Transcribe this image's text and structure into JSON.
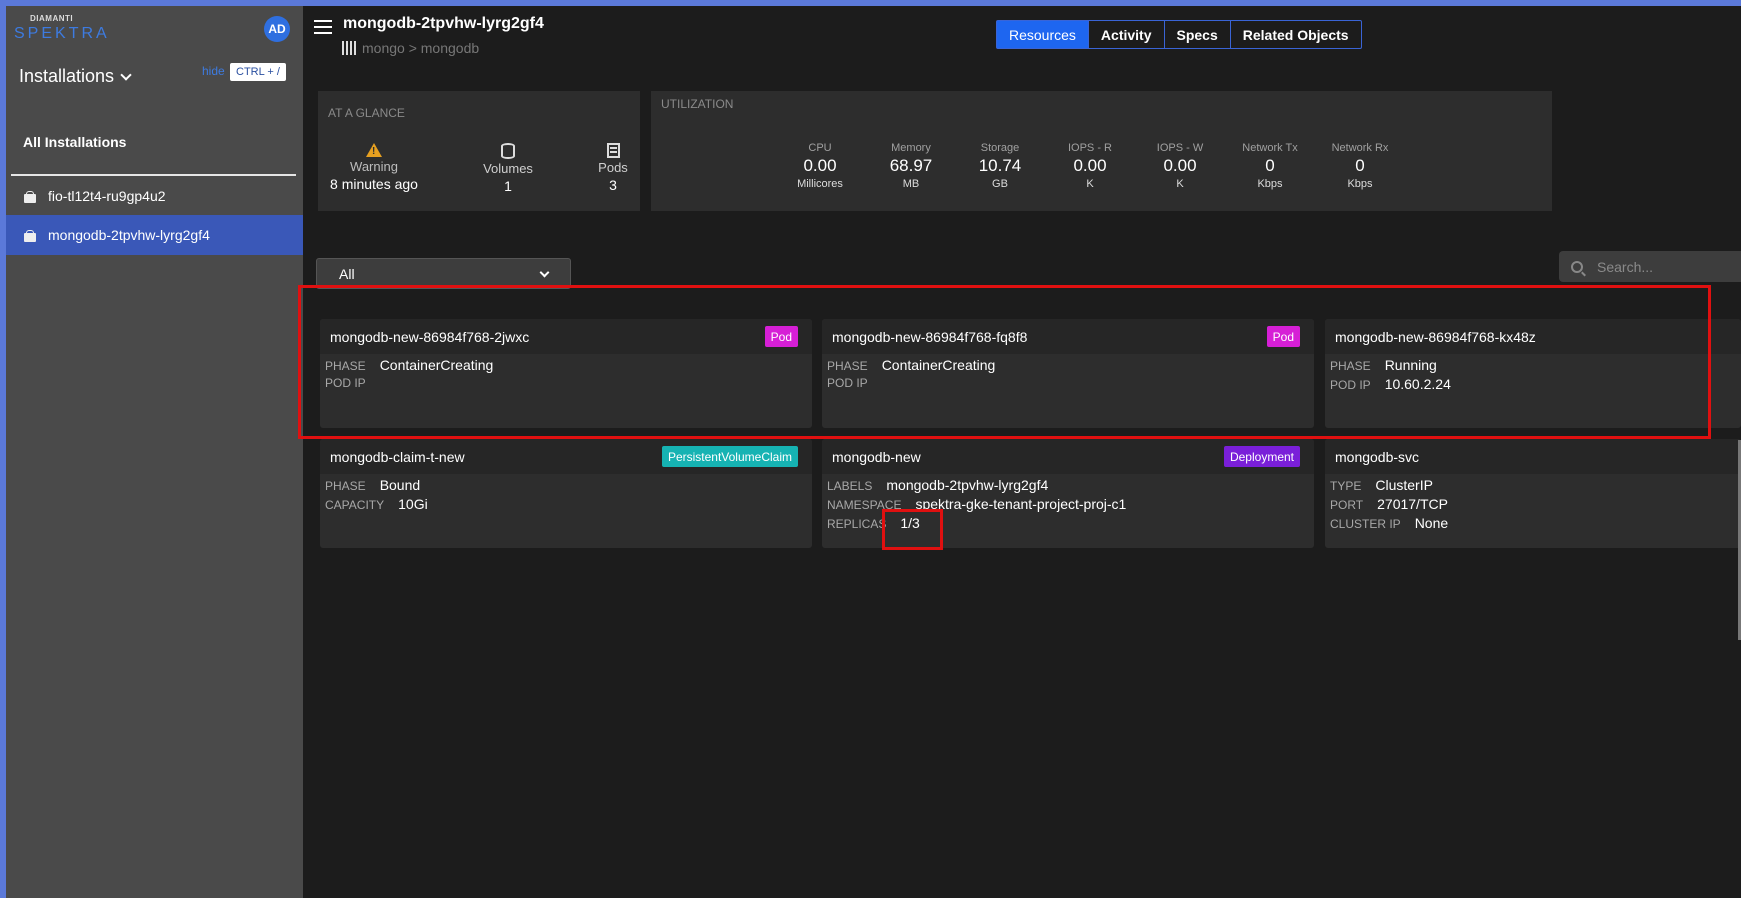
{
  "app": {
    "logo_top": "DIAMANTI",
    "logo_main": "SPEKTRA",
    "user_initials": "AD"
  },
  "sidebar": {
    "title": "Installations",
    "hide_label": "hide",
    "shortcut": "CTRL + /",
    "all_label": "All Installations",
    "items": [
      {
        "label": "fio-tl12t4-ru9gp4u2"
      },
      {
        "label": "mongodb-2tpvhw-lyrg2gf4"
      }
    ]
  },
  "header": {
    "title": "mongodb-2tpvhw-lyrg2gf4",
    "breadcrumb": "mongo > mongodb",
    "tabs": [
      "Resources",
      "Activity",
      "Specs",
      "Related Objects"
    ]
  },
  "glance": {
    "label": "AT A GLANCE",
    "status": "Warning",
    "status_time": "8 minutes ago",
    "volumes_label": "Volumes",
    "volumes": "1",
    "pods_label": "Pods",
    "pods": "3"
  },
  "utilization": {
    "label": "UTILIZATION",
    "metrics": [
      {
        "name": "CPU",
        "value": "0.00",
        "unit": "Millicores"
      },
      {
        "name": "Memory",
        "value": "68.97",
        "unit": "MB"
      },
      {
        "name": "Storage",
        "value": "10.74",
        "unit": "GB"
      },
      {
        "name": "IOPS - R",
        "value": "0.00",
        "unit": "K"
      },
      {
        "name": "IOPS - W",
        "value": "0.00",
        "unit": "K"
      },
      {
        "name": "Network Tx",
        "value": "0",
        "unit": "Kbps"
      },
      {
        "name": "Network Rx",
        "value": "0",
        "unit": "Kbps"
      }
    ]
  },
  "filter": {
    "value": "All"
  },
  "search": {
    "placeholder": "Search..."
  },
  "cards": [
    {
      "name": "mongodb-new-86984f768-2jwxc",
      "badge": "Pod",
      "rows": [
        {
          "k": "PHASE",
          "v": "ContainerCreating"
        },
        {
          "k": "POD IP",
          "v": ""
        }
      ]
    },
    {
      "name": "mongodb-new-86984f768-fq8f8",
      "badge": "Pod",
      "rows": [
        {
          "k": "PHASE",
          "v": "ContainerCreating"
        },
        {
          "k": "POD IP",
          "v": ""
        }
      ]
    },
    {
      "name": "mongodb-new-86984f768-kx48z",
      "badge": "",
      "rows": [
        {
          "k": "PHASE",
          "v": "Running"
        },
        {
          "k": "POD IP",
          "v": "10.60.2.24"
        }
      ]
    },
    {
      "name": "mongodb-claim-t-new",
      "badge": "PersistentVolumeClaim",
      "rows": [
        {
          "k": "PHASE",
          "v": "Bound"
        },
        {
          "k": "CAPACITY",
          "v": "10Gi"
        }
      ]
    },
    {
      "name": "mongodb-new",
      "badge": "Deployment",
      "rows": [
        {
          "k": "LABELS",
          "v": "mongodb-2tpvhw-lyrg2gf4"
        },
        {
          "k": "NAMESPACE",
          "v": "spektra-gke-tenant-project-proj-c1"
        },
        {
          "k": "REPLICAS",
          "v": "1/3"
        }
      ]
    },
    {
      "name": "mongodb-svc",
      "badge": "",
      "rows": [
        {
          "k": "TYPE",
          "v": "ClusterIP"
        },
        {
          "k": "PORT",
          "v": "27017/TCP"
        },
        {
          "k": "CLUSTER IP",
          "v": "None"
        }
      ]
    }
  ],
  "colors": {
    "accent": "#1e66f0",
    "highlight": "#e01010",
    "pod_badge": "#d61fd6",
    "pvc_badge": "#16b3b3",
    "deployment_badge": "#7a1fd9"
  }
}
